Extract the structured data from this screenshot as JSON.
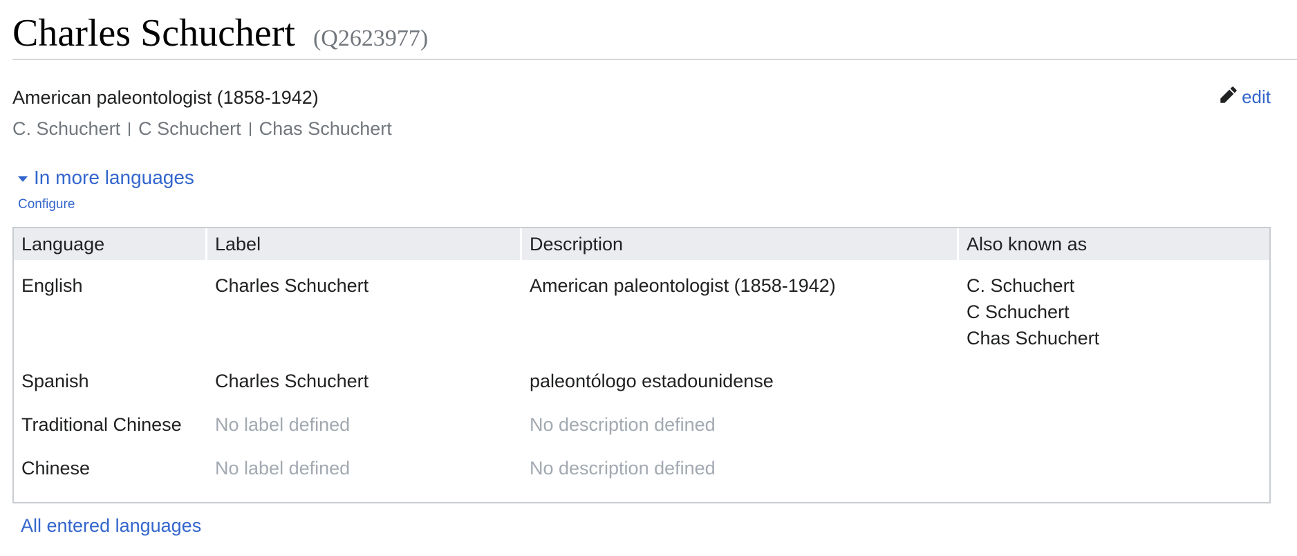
{
  "header": {
    "title": "Charles Schuchert",
    "entity_id": "(Q2623977)"
  },
  "summary": {
    "description": "American paleontologist (1858-1942)",
    "aliases": [
      "C. Schuchert",
      "C Schuchert",
      "Chas Schuchert"
    ]
  },
  "edit": {
    "label": "edit",
    "icon": "pencil-icon"
  },
  "more_languages": {
    "toggle_label": "In more languages",
    "configure_label": "Configure",
    "all_languages_label": "All entered languages"
  },
  "table": {
    "columns": [
      "Language",
      "Label",
      "Description",
      "Also known as"
    ],
    "rows": [
      {
        "language": "English",
        "label": "Charles Schuchert",
        "description": "American paleontologist (1858-1942)",
        "aliases": [
          "C. Schuchert",
          "C Schuchert",
          "Chas Schuchert"
        ]
      },
      {
        "language": "Spanish",
        "label": "Charles Schuchert",
        "description": "paleontólogo estadounidense",
        "aliases": []
      },
      {
        "language": "Traditional Chinese",
        "label": "No label defined",
        "description": "No description defined",
        "aliases": []
      },
      {
        "language": "Chinese",
        "label": "No label defined",
        "description": "No description defined",
        "aliases": []
      }
    ]
  },
  "colors": {
    "link": "#3366cc",
    "muted": "#a2a9b1",
    "alias_text": "#72777d",
    "table_header_bg": "#eaecf0",
    "table_border": "#c8ccd1"
  }
}
